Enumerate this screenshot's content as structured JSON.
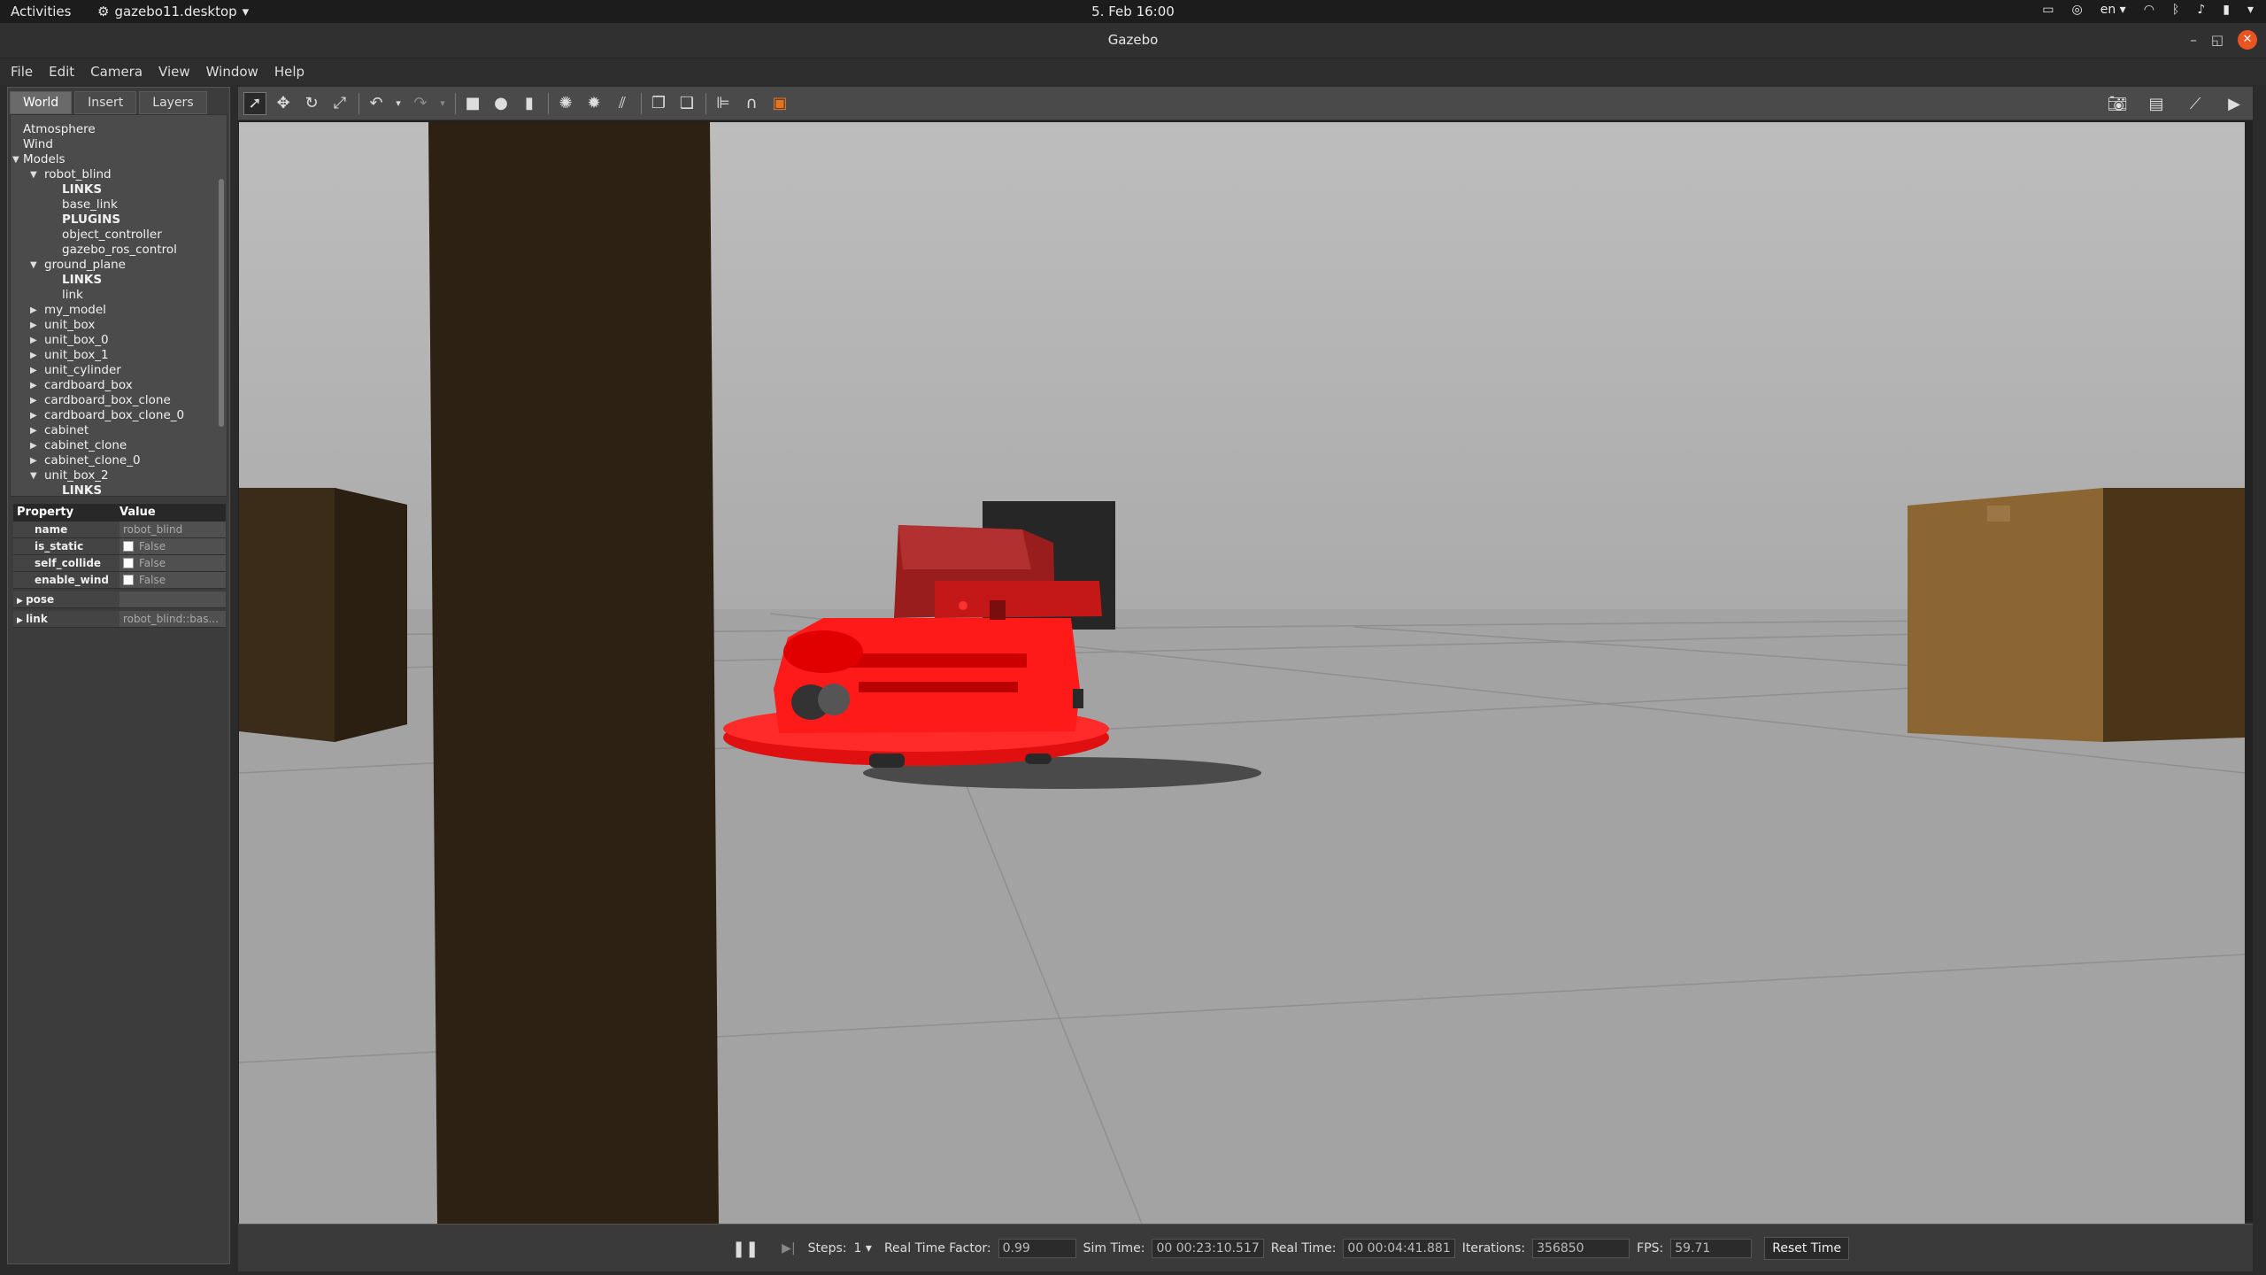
{
  "topbar": {
    "activities": "Activities",
    "app_name": "gazebo11.desktop",
    "clock": "5. Feb  16:00",
    "lang": "en"
  },
  "window": {
    "title": "Gazebo"
  },
  "menu": [
    "File",
    "Edit",
    "Camera",
    "View",
    "Window",
    "Help"
  ],
  "left_tabs": [
    "World",
    "Insert",
    "Layers"
  ],
  "tree": [
    {
      "label": "Atmosphere",
      "depth": 0,
      "caret": "",
      "bold": false
    },
    {
      "label": "Wind",
      "depth": 0,
      "caret": "",
      "bold": false
    },
    {
      "label": "Models",
      "depth": 0,
      "caret": "down",
      "bold": false
    },
    {
      "label": "robot_blind",
      "depth": 1,
      "caret": "down",
      "bold": false
    },
    {
      "label": "LINKS",
      "depth": 2,
      "caret": "",
      "bold": true
    },
    {
      "label": "base_link",
      "depth": 2,
      "caret": "",
      "bold": false
    },
    {
      "label": "PLUGINS",
      "depth": 2,
      "caret": "",
      "bold": true
    },
    {
      "label": "object_controller",
      "depth": 2,
      "caret": "",
      "bold": false
    },
    {
      "label": "gazebo_ros_control",
      "depth": 2,
      "caret": "",
      "bold": false
    },
    {
      "label": "ground_plane",
      "depth": 1,
      "caret": "down",
      "bold": false
    },
    {
      "label": "LINKS",
      "depth": 2,
      "caret": "",
      "bold": true
    },
    {
      "label": "link",
      "depth": 2,
      "caret": "",
      "bold": false
    },
    {
      "label": "my_model",
      "depth": 1,
      "caret": "right",
      "bold": false
    },
    {
      "label": "unit_box",
      "depth": 1,
      "caret": "right",
      "bold": false
    },
    {
      "label": "unit_box_0",
      "depth": 1,
      "caret": "right",
      "bold": false
    },
    {
      "label": "unit_box_1",
      "depth": 1,
      "caret": "right",
      "bold": false
    },
    {
      "label": "unit_cylinder",
      "depth": 1,
      "caret": "right",
      "bold": false
    },
    {
      "label": "cardboard_box",
      "depth": 1,
      "caret": "right",
      "bold": false
    },
    {
      "label": "cardboard_box_clone",
      "depth": 1,
      "caret": "right",
      "bold": false
    },
    {
      "label": "cardboard_box_clone_0",
      "depth": 1,
      "caret": "right",
      "bold": false
    },
    {
      "label": "cabinet",
      "depth": 1,
      "caret": "right",
      "bold": false
    },
    {
      "label": "cabinet_clone",
      "depth": 1,
      "caret": "right",
      "bold": false
    },
    {
      "label": "cabinet_clone_0",
      "depth": 1,
      "caret": "right",
      "bold": false
    },
    {
      "label": "unit_box_2",
      "depth": 1,
      "caret": "down",
      "bold": false
    },
    {
      "label": "LINKS",
      "depth": 2,
      "caret": "",
      "bold": true
    }
  ],
  "props": {
    "header_property": "Property",
    "header_value": "Value",
    "name_key": "name",
    "name_val": "robot_blind",
    "static_key": "is_static",
    "static_val": "False",
    "collide_key": "self_collide",
    "collide_val": "False",
    "wind_key": "enable_wind",
    "wind_val": "False",
    "pose_key": "pose",
    "link_key": "link",
    "link_val": "robot_blind::bas..."
  },
  "bottom": {
    "steps_label": "Steps:",
    "steps_val": "1",
    "rtf_label": "Real Time Factor:",
    "rtf_val": "0.99",
    "sim_label": "Sim Time:",
    "sim_val": "00 00:23:10.517",
    "real_label": "Real Time:",
    "real_val": "00 00:04:41.881",
    "iter_label": "Iterations:",
    "iter_val": "356850",
    "fps_label": "FPS:",
    "fps_val": "59.71",
    "reset_label": "Reset Time"
  },
  "colors": {
    "robot": "#ff1a1a",
    "sky": "#b5b5b5",
    "ground": "#a8a8a8",
    "pillar": "#2d2113",
    "cardboard": "#8a6330"
  }
}
